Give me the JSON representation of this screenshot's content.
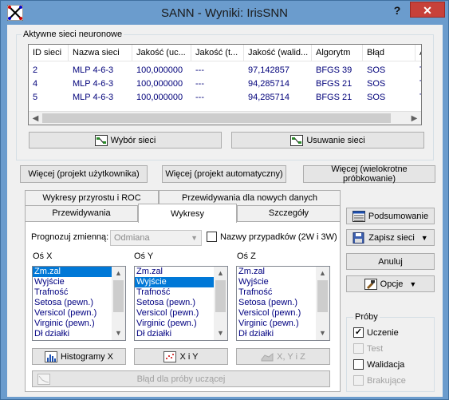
{
  "window": {
    "title": "SANN - Wyniki: IrisSNN",
    "help": "?",
    "close": "✕"
  },
  "networks": {
    "group_label": "Aktywne sieci neuronowe",
    "columns": [
      "ID sieci",
      "Nazwa sieci",
      "Jakość (uc...",
      "Jakość (t...",
      "Jakość (walid...",
      "Algorytm",
      "Błąd",
      "A"
    ],
    "rows": [
      [
        "2",
        "MLP 4-6-3",
        "100,000000",
        "---",
        "97,142857",
        "BFGS 39",
        "SOS",
        "T"
      ],
      [
        "4",
        "MLP 4-6-3",
        "100,000000",
        "---",
        "94,285714",
        "BFGS 21",
        "SOS",
        "T"
      ],
      [
        "5",
        "MLP 4-6-3",
        "100,000000",
        "---",
        "94,285714",
        "BFGS 21",
        "SOS",
        "T"
      ]
    ],
    "select_btn": "Wybór sieci",
    "remove_btn": "Usuwanie sieci"
  },
  "more": {
    "user": "Więcej (projekt użytkownika)",
    "auto": "Więcej (projekt automatyczny)",
    "multi": "Więcej (wielokrotne próbkowanie)"
  },
  "tabs": {
    "back": [
      "Wykresy przyrostu i ROC",
      "Przewidywania dla nowych danych"
    ],
    "front": [
      "Przewidywania",
      "Wykresy",
      "Szczegóły"
    ]
  },
  "plots": {
    "predict_label": "Prognozuj zmienną:",
    "predict_value": "Odmiana",
    "case_names": "Nazwy przypadków (2W i 3W)",
    "axis_x": "Oś X",
    "axis_y": "Oś Y",
    "axis_z": "Oś Z",
    "list_x": [
      "Zm.zal",
      "Wyjście",
      "Trafność",
      "Setosa (pewn.)",
      "Versicol (pewn.)",
      "Virginic (pewn.)",
      "Dł działki"
    ],
    "list_y": [
      "Zm.zal",
      "Wyjście",
      "Trafność",
      "Setosa (pewn.)",
      "Versicol (pewn.)",
      "Virginic (pewn.)",
      "Dł działki"
    ],
    "list_z": [
      "Zm.zal",
      "Wyjście",
      "Trafność",
      "Setosa (pewn.)",
      "Versicol (pewn.)",
      "Virginic (pewn.)",
      "Dł działki"
    ],
    "hist_btn": "Histogramy X",
    "xy_btn": "X i Y",
    "xyz_btn": "X, Y i Z",
    "error_btn": "Błąd dla próby uczącej"
  },
  "right": {
    "summary": "Podsumowanie",
    "save": "Zapisz sieci",
    "cancel": "Anuluj",
    "options": "Opcje",
    "samples_title": "Próby",
    "training": "Uczenie",
    "test": "Test",
    "validation": "Walidacja",
    "missing": "Brakujące"
  },
  "colors": {
    "selection": "#0078d7",
    "data_text": "#00007a",
    "titlebar": "#6b9ccd",
    "close": "#c7413a"
  }
}
